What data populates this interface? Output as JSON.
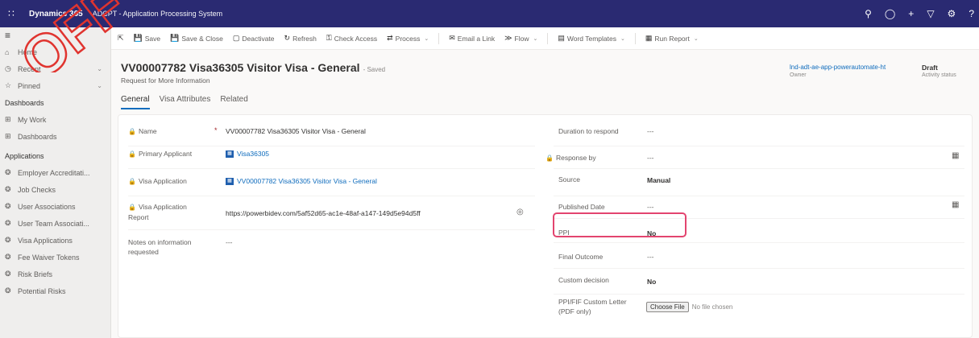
{
  "topbar": {
    "app_name": "Dynamics 365",
    "app_description": "ADCPT - Application Processing System",
    "icons": [
      "search-icon",
      "lightbulb-icon",
      "plus-icon",
      "filter-icon",
      "gear-icon",
      "help-icon"
    ]
  },
  "watermark": {
    "text": "OFF"
  },
  "nav": {
    "items": [
      {
        "label": "Home",
        "icon": "home-icon"
      },
      {
        "label": "Recent",
        "icon": "clock-icon",
        "chevron": true
      },
      {
        "label": "Pinned",
        "icon": "pin-icon",
        "chevron": true
      }
    ],
    "sections": [
      {
        "title": "Dashboards",
        "items": [
          {
            "label": "My Work",
            "icon": "grid-icon"
          },
          {
            "label": "Dashboards",
            "icon": "grid-icon"
          }
        ]
      },
      {
        "title": "Applications",
        "items": [
          {
            "label": "Employer Accreditati...",
            "icon": "entity-icon"
          },
          {
            "label": "Job Checks",
            "icon": "entity-icon"
          },
          {
            "label": "User Associations",
            "icon": "entity-icon"
          },
          {
            "label": "User Team Associati...",
            "icon": "entity-icon"
          },
          {
            "label": "Visa Applications",
            "icon": "entity-icon"
          },
          {
            "label": "Fee Waiver Tokens",
            "icon": "entity-icon"
          },
          {
            "label": "Risk Briefs",
            "icon": "entity-icon"
          },
          {
            "label": "Potential Risks",
            "icon": "entity-icon"
          }
        ]
      }
    ]
  },
  "commands": {
    "save": "Save",
    "save_close": "Save & Close",
    "deactivate": "Deactivate",
    "refresh": "Refresh",
    "check_access": "Check Access",
    "process": "Process",
    "email_link": "Email a Link",
    "flow": "Flow",
    "word_templates": "Word Templates",
    "run_report": "Run Report"
  },
  "header": {
    "title": "VV00007782 Visa36305 Visitor Visa - General",
    "saved": "- Saved",
    "subtitle": "Request for More Information",
    "owner_value": "lnd-adt-ae-app-powerautomate-ht",
    "owner_label": "Owner",
    "status_value": "Draft",
    "status_label": "Activity status"
  },
  "tabs": [
    "General",
    "Visa Attributes",
    "Related"
  ],
  "form": {
    "left": {
      "name_label": "Name",
      "name_value": "VV00007782 Visa36305 Visitor Visa - General",
      "applicant_label": "Primary Applicant",
      "applicant_value": "Visa36305",
      "application_label": "Visa Application",
      "application_value": "VV00007782 Visa36305 Visitor Visa - General",
      "report_label": "Visa Application Report",
      "report_value": "https://powerbidev.com/5af52d65-ac1e-48af-a147-149d5e94d5ff",
      "notes_label": "Notes on information requested",
      "notes_value": "---"
    },
    "right": {
      "duration_label": "Duration to respond",
      "duration_value": "---",
      "response_label": "Response by",
      "response_value": "---",
      "source_label": "Source",
      "source_value": "Manual",
      "published_label": "Published Date",
      "published_value": "---",
      "ppi_label": "PPI",
      "ppi_value": "No",
      "outcome_label": "Final Outcome",
      "outcome_value": "---",
      "custom_label": "Custom decision",
      "custom_value": "No",
      "letter_label": "PPI/FIF Custom Letter (PDF only)",
      "choose_file": "Choose File",
      "no_file": "No file chosen"
    }
  }
}
